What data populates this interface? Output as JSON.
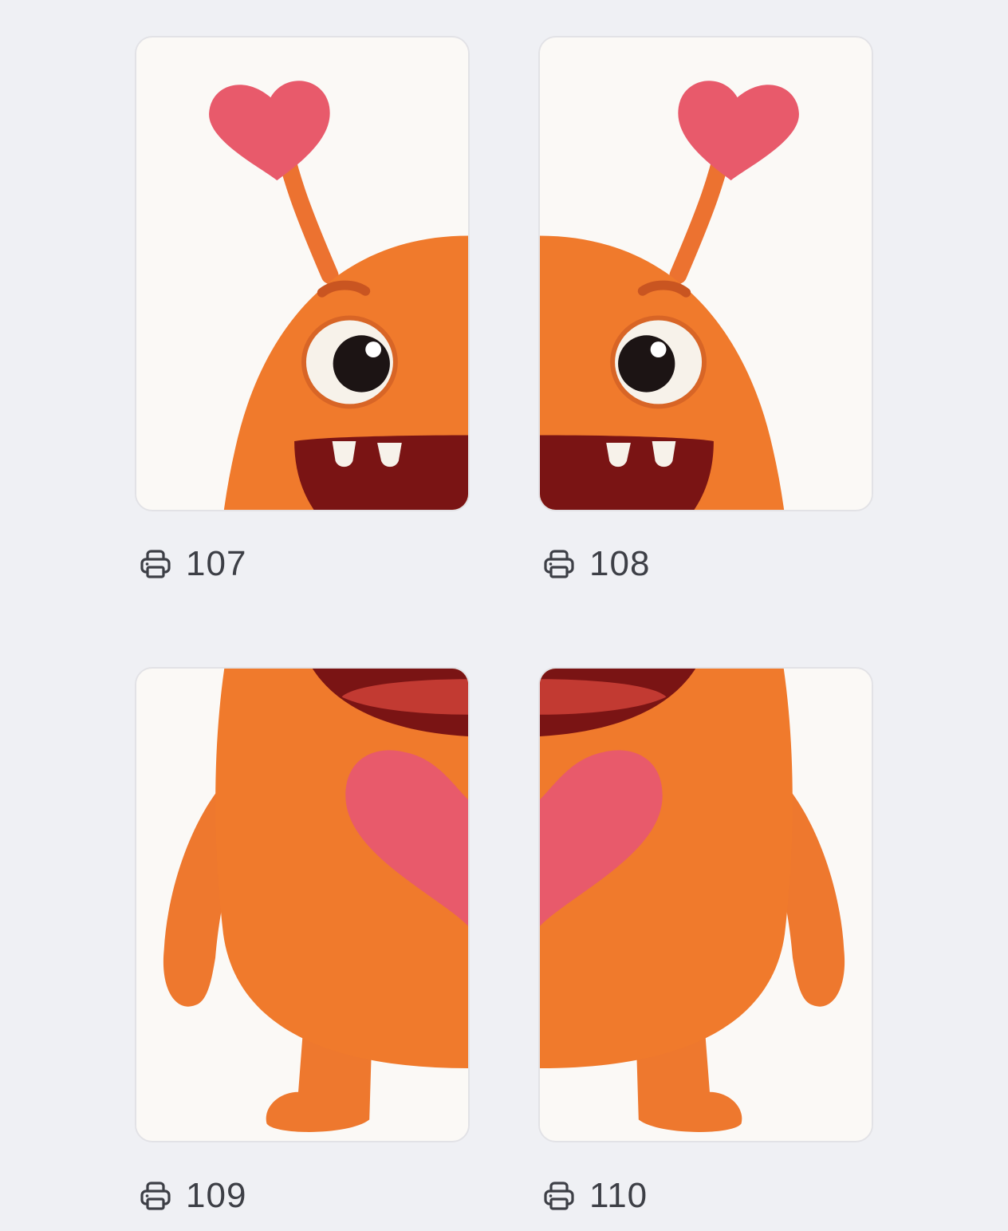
{
  "pages": [
    {
      "number": "107",
      "icon": "printer-icon",
      "image": "monster-top-left"
    },
    {
      "number": "108",
      "icon": "printer-icon",
      "image": "monster-top-right"
    },
    {
      "number": "109",
      "icon": "printer-icon",
      "image": "monster-bottom-left"
    },
    {
      "number": "110",
      "icon": "printer-icon",
      "image": "monster-bottom-right"
    }
  ],
  "colors": {
    "background": "#eff0f4",
    "paper": "#fbf9f6",
    "monster": "#f07a2c",
    "heart": "#e85a6b",
    "mouth": "#7a1414"
  }
}
